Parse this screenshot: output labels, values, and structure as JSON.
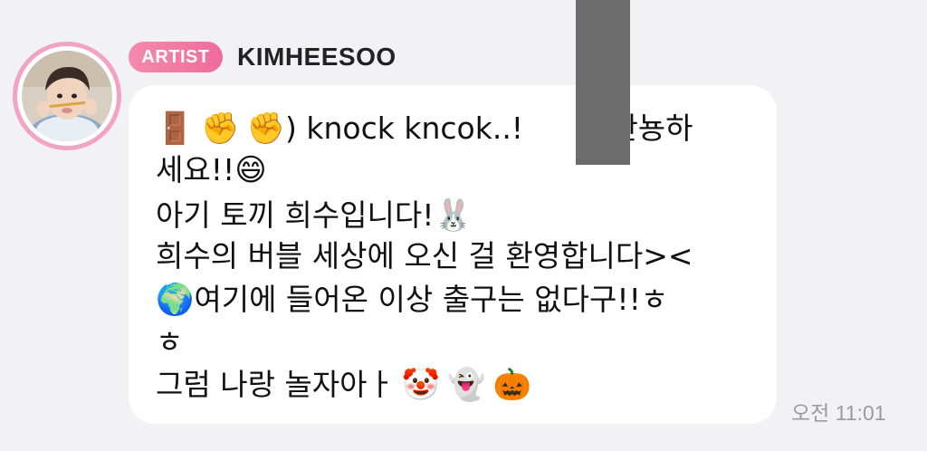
{
  "sender": {
    "badge": "ARTIST",
    "name": "KIMHEESOO",
    "avatar": "avatar"
  },
  "message": {
    "lines": [
      {
        "icons": [
          "door-emoji",
          "raised-fist-emoji",
          "raised-fist-emoji"
        ],
        "text": ") knock kncok..! ",
        "tail": "- 안뇽하"
      },
      {
        "text": "세요!!",
        "icons": [
          "grinning-face-emoji"
        ]
      },
      {
        "text": "아기 토끼 희수입니다!",
        "icons": [
          "rabbit-face-emoji"
        ]
      },
      {
        "text": "희수의 버블 세상에 오신 걸 환영합니다><"
      },
      {
        "icons": [
          "globe-emoji"
        ],
        "text": " 여기에 들어온 이상 출구는 없다구!!ㅎ"
      },
      {
        "text": "ㅎ"
      },
      {
        "text": "그럼 나랑 놀자아ㅏ ",
        "icons": [
          "clown-face-emoji",
          "ghost-emoji",
          "jack-o-lantern-emoji"
        ]
      }
    ],
    "time": "오전 11:01"
  },
  "colors": {
    "background": "#f2f2f5",
    "bubble": "#ffffff",
    "badge": "#f06c9a",
    "avatar_ring": "#f2a3c2",
    "timestamp": "#9a9aa0"
  }
}
